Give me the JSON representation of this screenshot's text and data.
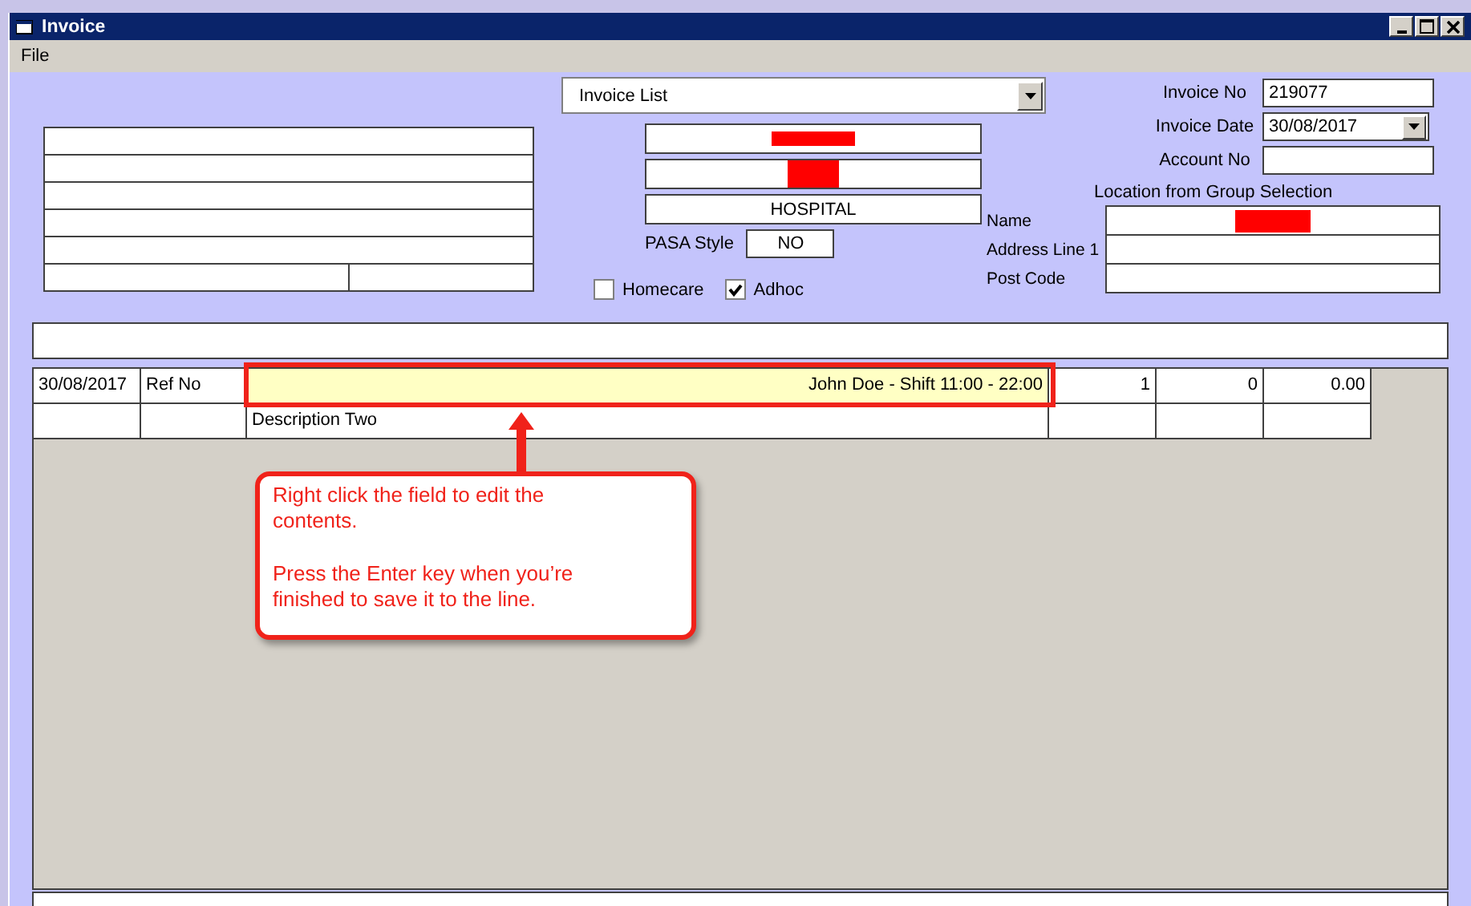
{
  "window": {
    "title": "Invoice"
  },
  "menu": [
    "File"
  ],
  "invoice_list": {
    "value": "Invoice List"
  },
  "customer_fields": [
    {
      "kind": "redacted"
    },
    {
      "kind": "redacted"
    },
    {
      "kind": "text",
      "value": "HOSPITAL"
    }
  ],
  "pasa_style": {
    "label": "PASA Style",
    "value": "NO"
  },
  "options": [
    {
      "label": "Homecare",
      "checked": false
    },
    {
      "label": "Adhoc",
      "checked": true
    }
  ],
  "invoice_fields": [
    {
      "label": "Invoice No",
      "kind": "text",
      "value": "219077"
    },
    {
      "label": "Invoice Date",
      "kind": "dropdown",
      "value": "30/08/2017"
    },
    {
      "label": "Account No",
      "kind": "text"
    }
  ],
  "location": {
    "heading": "Location from Group Selection",
    "fields": [
      {
        "label": "Name",
        "kind": "redacted"
      },
      {
        "label": "Address Line 1",
        "kind": "text"
      },
      {
        "label": "Post Code",
        "kind": "text"
      }
    ]
  },
  "lines": [
    {
      "cells": [
        "30/08/2017",
        "Ref No",
        "John Doe - Shift 11:00 - 22:00",
        "1",
        "0",
        "0.00"
      ],
      "editing": true
    },
    {
      "description": "Description Two",
      "editing": false
    }
  ],
  "callout": {
    "paragraphs": [
      "Right click the field to edit the contents.",
      "Press the Enter key when you’re finished to save it to the line."
    ]
  }
}
